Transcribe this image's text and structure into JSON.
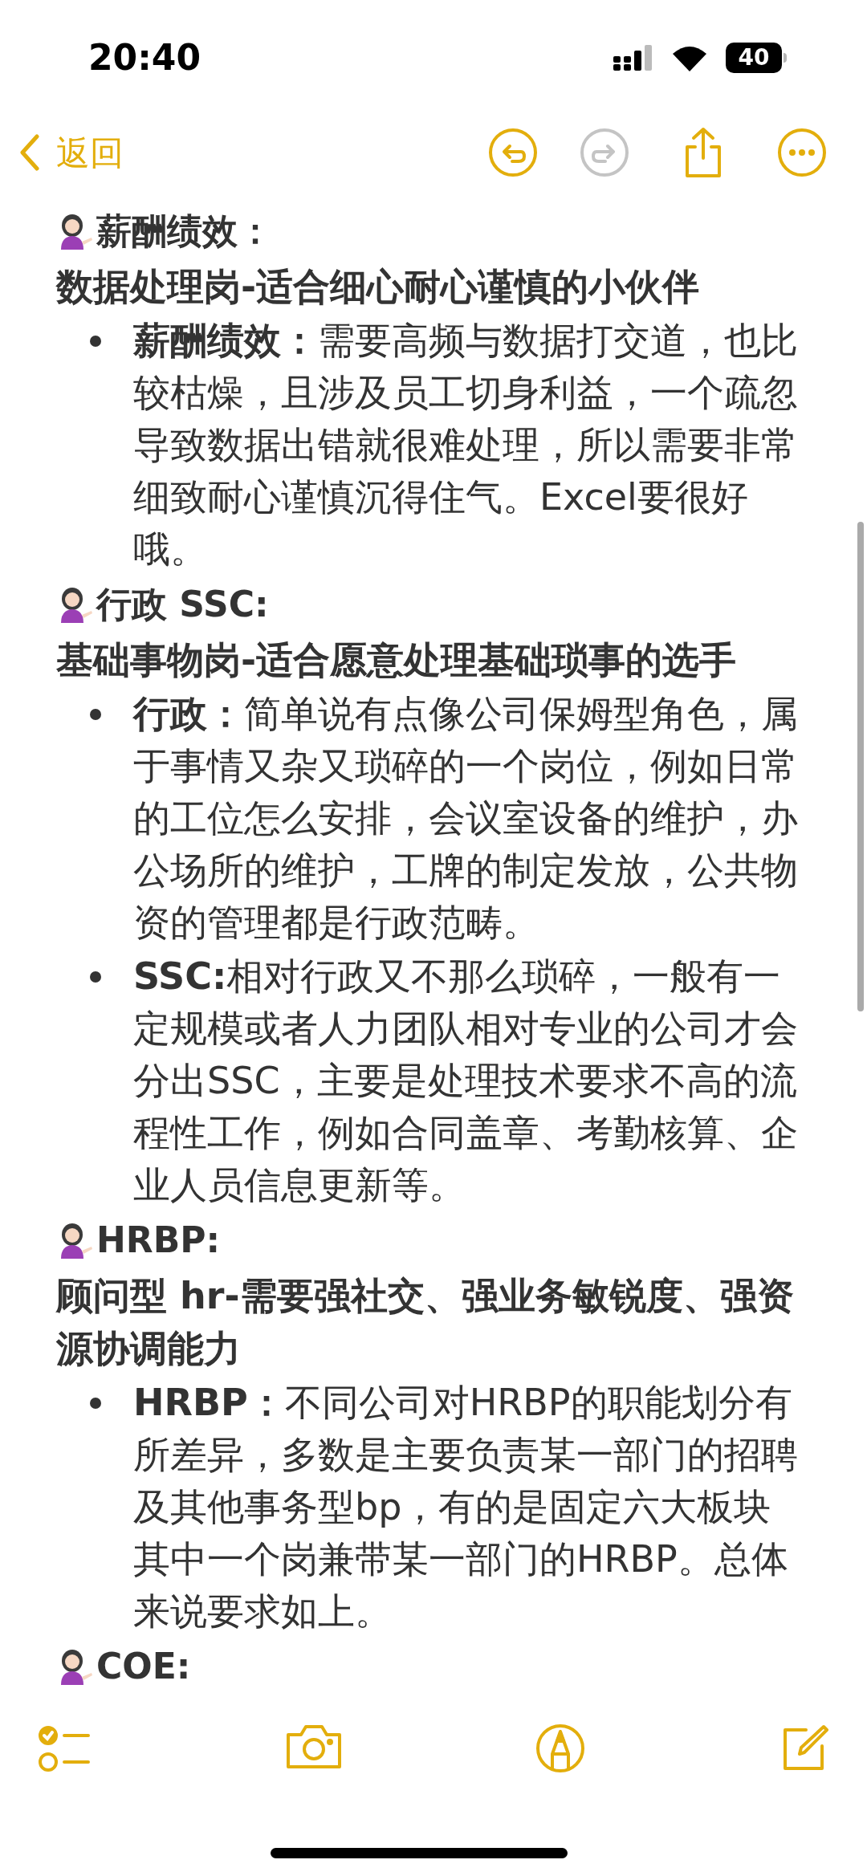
{
  "status_bar": {
    "time": "20:40",
    "battery": "40"
  },
  "nav": {
    "back": "返回",
    "undo": {
      "disabled": false
    },
    "redo": {
      "disabled": true
    }
  },
  "sections": [
    {
      "title": "薪酬绩效：",
      "subtitle": "数据处理岗-适合细心耐心谨慎的小伙伴",
      "bullets": [
        "**薪酬绩效：**需要高频与数据打交道，也比较枯燥，且涉及员工切身利益，一个疏忽导致数据出错就很难处理，所以需要非常细致耐心谨慎沉得住气。Excel要很好哦。"
      ]
    },
    {
      "title": "行政 SSC:",
      "subtitle": "基础事物岗-适合愿意处理基础琐事的选手",
      "bullets": [
        "**行政：**简单说有点像公司保姆型角色，属于事情又杂又琐碎的一个岗位，例如日常的工位怎么安排，会议室设备的维护，办公场所的维护，工牌的制定发放，公共物资的管理都是行政范畴。",
        "**SSC:**相对行政又不那么琐碎，一般有一定规模或者人力团队相对专业的公司才会分出SSC，主要是处理技术要求不高的流程性工作，例如合同盖章、考勤核算、企业人员信息更新等。"
      ]
    },
    {
      "title": "HRBP:",
      "subtitle": "顾问型 hr-需要强社交、强业务敏锐度、强资源协调能力",
      "bullets": [
        "**HRBP：**不同公司对HRBP的职能划分有所差异，多数是主要负责某一部门的招聘及其他事务型bp，有的是固定六大板块其中一个岗兼带某一部门的HRBP。总体来说要求如上。"
      ]
    },
    {
      "title": "COE:"
    }
  ]
}
